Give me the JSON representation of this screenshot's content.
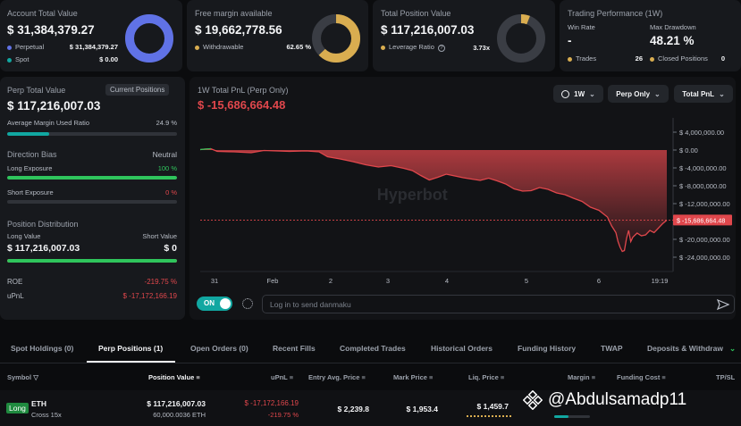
{
  "colors": {
    "red": "#e0474c",
    "green": "#2fc55c",
    "blue": "#6072e6",
    "gold": "#d9ad50",
    "teal": "#11a7a1",
    "gray": "#4a4a4a"
  },
  "account": {
    "title": "Account Total Value",
    "value": "$ 31,384,379.27",
    "perpetual_label": "Perpetual",
    "perpetual_value": "$ 31,384,379.27",
    "spot_label": "Spot",
    "spot_value": "$ 0.00",
    "donut_fraction": 1.0
  },
  "margin": {
    "title": "Free margin available",
    "value": "$ 19,662,778.56",
    "withdrawable_label": "Withdrawable",
    "withdrawable_value": "62.65 %",
    "donut_fraction": 0.6265
  },
  "position": {
    "title": "Total Position Value",
    "value": "$ 117,216,007.03",
    "leverage_label": "Leverage Ratio",
    "leverage_value": "3.73x",
    "donut_fraction": 0.06
  },
  "performance": {
    "title": "Trading Performance (1W)",
    "win_rate_label": "Win Rate",
    "win_rate_value": "-",
    "drawdown_label": "Max Drawdown",
    "drawdown_value": "48.21 %",
    "trades_label": "Trades",
    "trades_value": "26",
    "closed_label": "Closed Positions",
    "closed_value": "0"
  },
  "perp": {
    "title": "Perp Total Value",
    "current_positions_button": "Current Positions",
    "value": "$ 117,216,007.03",
    "avg_margin_label": "Average Margin Used Ratio",
    "avg_margin_value": "24.9 %",
    "avg_margin_fraction": 0.249,
    "bias_label": "Direction Bias",
    "bias_value": "Neutral",
    "long_exposure_label": "Long Exposure",
    "long_exposure_value": "100 %",
    "long_exposure_fraction": 1.0,
    "short_exposure_label": "Short Exposure",
    "short_exposure_value": "0 %",
    "short_exposure_fraction": 0.0,
    "distribution_label": "Position Distribution",
    "long_value_label": "Long Value",
    "long_value": "$ 117,216,007.03",
    "short_value_label": "Short Value",
    "short_value": "$ 0",
    "long_fraction": 1.0,
    "roe_label": "ROE",
    "roe_value": "-219.75 %",
    "upnl_label": "uPnL",
    "upnl_value": "$ -17,172,166.19"
  },
  "chart_header": {
    "title": "1W Total PnL (Perp Only)",
    "value": "$ -15,686,664.48",
    "period": "1W",
    "scope": "Perp Only",
    "metric": "Total PnL"
  },
  "chart_data": {
    "type": "area",
    "ylim": [
      -26000000,
      6000000
    ],
    "yticks": [
      4000000,
      0,
      -4000000,
      -8000000,
      -12000000,
      -16000000,
      -20000000,
      -24000000
    ],
    "ytick_labels": [
      "$ 4,000,000.00",
      "$ 0.00",
      "$ -4,000,000.00",
      "$ -8,000,000.00",
      "$ -12,000,000.00",
      "$ -16,000,000.00",
      "$ -20,000,000.00",
      "$ -24,000,000.00"
    ],
    "xtick_labels": [
      "31",
      "Feb",
      "2",
      "3",
      "4",
      "5",
      "6",
      "19:19"
    ],
    "current_value_label": "$ -15,686,664.48",
    "current_value": -15686664.48,
    "watermark": "Hyperbot",
    "points": [
      [
        0.0,
        0.1
      ],
      [
        0.01,
        0.2
      ],
      [
        0.025,
        0.3
      ],
      [
        0.04,
        -0.3
      ],
      [
        0.08,
        -0.4
      ],
      [
        0.12,
        -0.6
      ],
      [
        0.15,
        -0.1
      ],
      [
        0.18,
        -0.2
      ],
      [
        0.21,
        -0.3
      ],
      [
        0.25,
        -0.2
      ],
      [
        0.28,
        -0.4
      ],
      [
        0.3,
        -1.5
      ],
      [
        0.33,
        -2.0
      ],
      [
        0.36,
        -2.6
      ],
      [
        0.39,
        -3.3
      ],
      [
        0.42,
        -3.8
      ],
      [
        0.45,
        -3.5
      ],
      [
        0.48,
        -4.1
      ],
      [
        0.5,
        -4.6
      ],
      [
        0.52,
        -5.7
      ],
      [
        0.54,
        -6.7
      ],
      [
        0.56,
        -6.1
      ],
      [
        0.58,
        -5.4
      ],
      [
        0.6,
        -5.8
      ],
      [
        0.62,
        -6.2
      ],
      [
        0.64,
        -6.5
      ],
      [
        0.66,
        -6.8
      ],
      [
        0.68,
        -6.3
      ],
      [
        0.7,
        -6.9
      ],
      [
        0.72,
        -7.6
      ],
      [
        0.74,
        -8.7
      ],
      [
        0.76,
        -9.2
      ],
      [
        0.78,
        -9.1
      ],
      [
        0.8,
        -8.4
      ],
      [
        0.82,
        -8.8
      ],
      [
        0.84,
        -9.6
      ],
      [
        0.86,
        -10.0
      ],
      [
        0.88,
        -10.8
      ],
      [
        0.9,
        -11.5
      ],
      [
        0.92,
        -12.8
      ],
      [
        0.94,
        -13.5
      ],
      [
        0.96,
        -15.0
      ],
      [
        0.97,
        -17.0
      ],
      [
        0.98,
        -18.5
      ],
      [
        0.985,
        -20.5
      ],
      [
        0.99,
        -21.8
      ],
      [
        0.995,
        -22.7
      ],
      [
        1.0,
        -22.5
      ],
      [
        1.005,
        -19.8
      ],
      [
        1.01,
        -18.0
      ],
      [
        1.015,
        -20.5
      ],
      [
        1.02,
        -19.5
      ],
      [
        1.03,
        -18.6
      ],
      [
        1.04,
        -19.2
      ],
      [
        1.05,
        -19.0
      ],
      [
        1.06,
        -18.0
      ],
      [
        1.07,
        -18.5
      ],
      [
        1.08,
        -17.5
      ],
      [
        1.09,
        -16.5
      ],
      [
        1.1,
        -15.7
      ]
    ]
  },
  "danmaku": {
    "toggle_label": "ON",
    "placeholder": "Log in to send danmaku"
  },
  "tabs": [
    "Spot Holdings (0)",
    "Perp Positions (1)",
    "Open Orders (0)",
    "Recent Fills",
    "Completed Trades",
    "Historical Orders",
    "Funding History",
    "TWAP",
    "Deposits & Withdraw"
  ],
  "table": {
    "headers": [
      "Symbol",
      "Position Value",
      "uPnL",
      "Entry Avg. Price",
      "Mark Price",
      "Liq. Price",
      "Margin",
      "Funding Cost",
      "TP/SL"
    ],
    "row": {
      "side": "Long",
      "symbol": "ETH",
      "mode": "Cross 15x",
      "position_value": "$ 117,216,007.03",
      "position_size": "60,000.0036 ETH",
      "upnl": "$ -17,172,166.19",
      "upnl_pct": "-219.75 %",
      "entry": "$ 2,239.8",
      "mark": "$ 1,953.4",
      "liq": "$ 1,459.7"
    }
  },
  "watermark": "@Abdulsamadp11"
}
